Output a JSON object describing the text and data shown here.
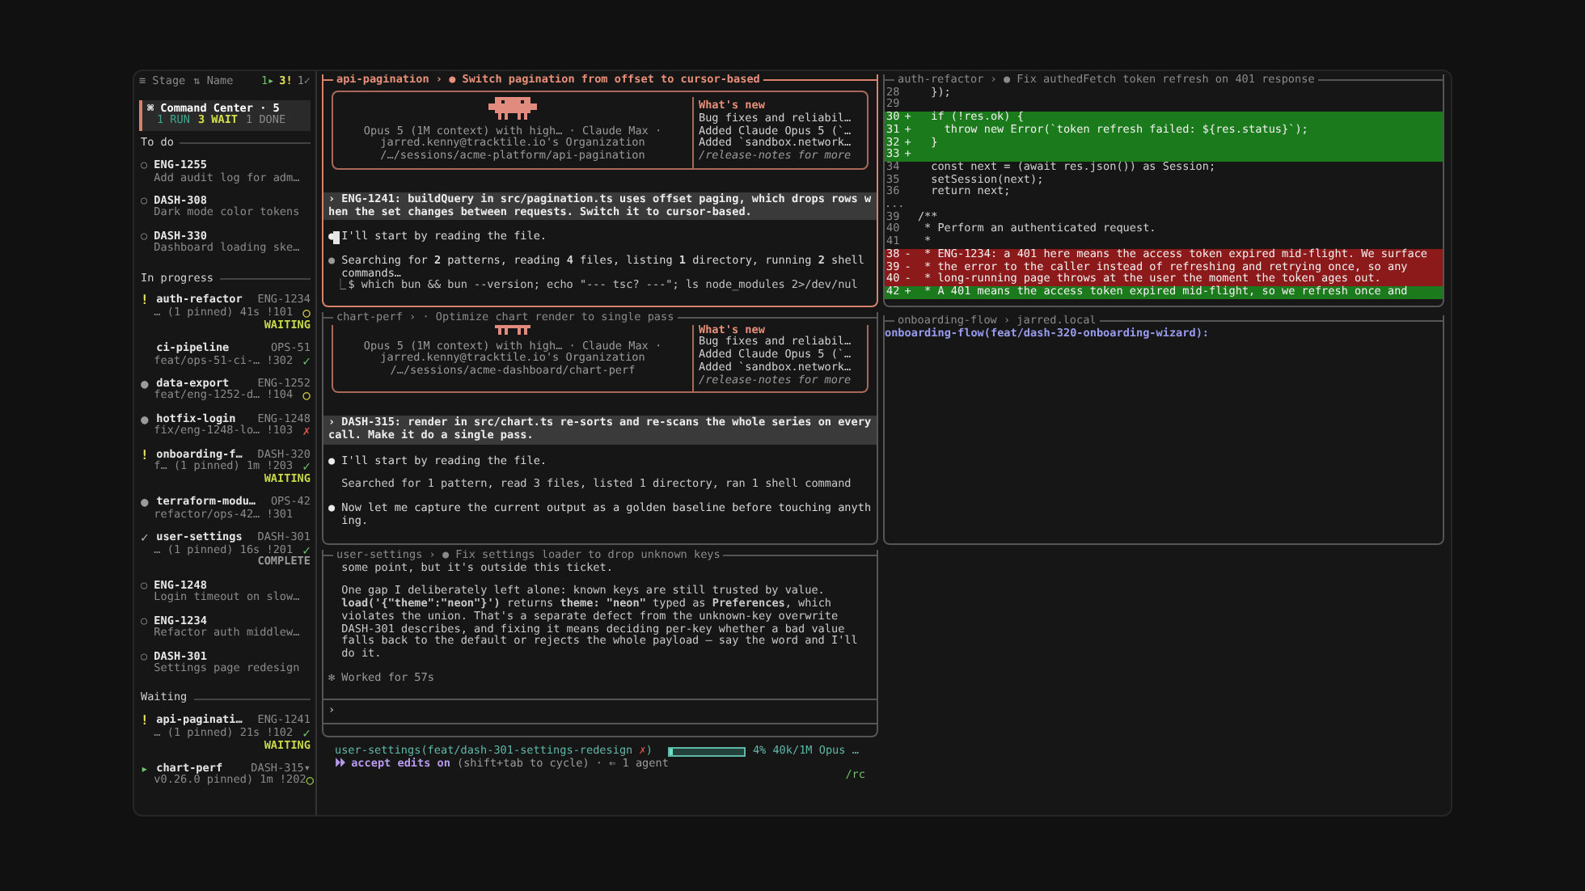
{
  "sidebar": {
    "header": {
      "stage": "≡ Stage",
      "sort": "⇅ Name",
      "counts": [
        {
          "text": "1▸",
          "kind": "run"
        },
        {
          "text": "3!",
          "kind": "wait"
        },
        {
          "text": "1✓",
          "kind": "done"
        }
      ]
    },
    "command_center": {
      "title": "⌘ Command Center · 5",
      "stats": [
        {
          "text": "1 RUN",
          "kind": "run"
        },
        {
          "text": "3 WAIT",
          "kind": "wait"
        },
        {
          "text": "1 DONE",
          "kind": "done"
        }
      ]
    },
    "groups": [
      {
        "title": "To do",
        "items": [
          {
            "kind": "ticket",
            "marker": "○",
            "id": "ENG-1255",
            "summary": "Add audit log for adm…"
          },
          {
            "kind": "ticket",
            "marker": "○",
            "id": "DASH-308",
            "summary": "Dark mode color tokens"
          },
          {
            "kind": "ticket",
            "marker": "○",
            "id": "DASH-330",
            "summary": "Dashboard loading ske…"
          }
        ]
      },
      {
        "title": "In progress",
        "items": [
          {
            "kind": "session",
            "marker": "!",
            "color": "#e6e05a",
            "name": "auth-refactor",
            "ticket": "ENG-1234",
            "detail": "… (1 pinned) 41s !101",
            "status_icon": {
              "glyph": "○",
              "color": "#d8c94a"
            },
            "status": {
              "text": "WAITING",
              "kind": "waiting"
            }
          },
          {
            "kind": "session",
            "name": "ci-pipeline",
            "ticket": "OPS-51",
            "detail": "feat/ops-51-ci-… !302",
            "status_icon": {
              "glyph": "✓",
              "color": "#6fc26a"
            }
          },
          {
            "kind": "session",
            "marker": "●",
            "color": "#9a9a9a",
            "name": "data-export",
            "ticket": "ENG-1252",
            "detail": "feat/eng-1252-d… !104",
            "status_icon": {
              "glyph": "○",
              "color": "#d8c94a"
            }
          },
          {
            "kind": "session",
            "marker": "●",
            "color": "#9a9a9a",
            "name": "hotfix-login",
            "ticket": "ENG-1248",
            "detail": "fix/eng-1248-lo… !103",
            "status_icon": {
              "glyph": "✗",
              "color": "#d9534a"
            }
          },
          {
            "kind": "session",
            "marker": "!",
            "color": "#e6e05a",
            "name": "onboarding-f…",
            "ticket": "DASH-320",
            "detail": "f… (1 pinned) 1m !203",
            "status_icon": {
              "glyph": "✓",
              "color": "#6fc26a"
            },
            "status": {
              "text": "WAITING",
              "kind": "waiting"
            }
          },
          {
            "kind": "session",
            "marker": "●",
            "color": "#9a9a9a",
            "name": "terraform-modu…",
            "ticket": "OPS-42",
            "detail": "refactor/ops-42… !301"
          },
          {
            "kind": "session",
            "marker": "✓",
            "color": "#b4b4b4",
            "name": "user-settings",
            "ticket": "DASH-301",
            "detail": "… (1 pinned) 16s !201",
            "status_icon": {
              "glyph": "✓",
              "color": "#6fc26a"
            },
            "status": {
              "text": "COMPLETE",
              "kind": "complete"
            }
          },
          {
            "kind": "ticket",
            "marker": "○",
            "id": "ENG-1248",
            "summary": "Login timeout on slow…"
          },
          {
            "kind": "ticket",
            "marker": "○",
            "id": "ENG-1234",
            "summary": "Refactor auth middlew…"
          },
          {
            "kind": "ticket",
            "marker": "○",
            "id": "DASH-301",
            "summary": "Settings page redesign"
          }
        ]
      },
      {
        "title": "Waiting",
        "items": [
          {
            "kind": "session",
            "marker": "!",
            "color": "#e6e05a",
            "name": "api-paginati…",
            "ticket": "ENG-1241",
            "detail": "… (1 pinned) 21s !102",
            "status_icon": {
              "glyph": "✓",
              "color": "#6fc26a"
            },
            "status": {
              "text": "WAITING",
              "kind": "waiting"
            }
          },
          {
            "kind": "session",
            "marker": "▸",
            "color": "#6fc26a",
            "name": "chart-perf",
            "ticket": "DASH-315▾",
            "detail": "v0.26.0 pinned) 1m !202",
            "status_icon": {
              "glyph": "○",
              "color": "#8fc24a"
            }
          }
        ]
      }
    ]
  },
  "middle_column": {
    "panes": [
      {
        "kind": "chat",
        "focused": true,
        "title": "api-pagination › ● Switch pagination from offset to cursor-based",
        "welcome": {
          "cut_off": false,
          "lines": [
            "Opus 5 (1M context) with high… · Claude Max ·",
            "jarred.kenny@tracktile.io's Organization",
            "/…/sessions/acme-platform/api-pagination"
          ],
          "whats_new": {
            "title": "What's new",
            "lines": [
              "Bug fixes and reliabil…",
              "Added Claude Opus 5 (`…",
              "Added `sandbox.network…"
            ],
            "footer": "/release-notes for more"
          }
        },
        "prompt": {
          "mark": "›",
          "text": "ENG-1241: buildQuery in src/pagination.ts uses offset paging, which drops rows when the set changes between requests. Switch it to cursor-based."
        },
        "messages": [
          {
            "kind": "assistant",
            "bullet": "●",
            "cursor": true,
            "text": "I'll start by reading the file."
          },
          {
            "kind": "tool",
            "bullet": "●",
            "text": "Searching for **2** patterns, reading **4** files, listing **1** directory, running **2** shell commands…"
          },
          {
            "kind": "output",
            "mark": "⎿",
            "text": "$ which bun && bun --version; echo \"--- tsc? ---\"; ls node_modules 2>/dev/nul"
          }
        ]
      },
      {
        "kind": "chat",
        "focused": false,
        "title": "chart-perf › · Optimize chart render to single pass",
        "welcome": {
          "cut_off": true,
          "lines": [
            "Opus 5 (1M context) with high… · Claude Max ·",
            "jarred.kenny@tracktile.io's Organization",
            "/…/sessions/acme-dashboard/chart-perf"
          ],
          "whats_new": {
            "title": "What's new",
            "lines": [
              "Bug fixes and reliabil…",
              "Added Claude Opus 5 (`…",
              "Added `sandbox.network…"
            ],
            "footer": "/release-notes for more"
          }
        },
        "prompt": {
          "mark": "›",
          "text": "DASH-315: render in src/chart.ts re-sorts and re-scans the whole series on every call. Make it do a single pass."
        },
        "messages": [
          {
            "kind": "assistant",
            "bullet": "●",
            "cursor": false,
            "text": "I'll start by reading the file."
          },
          {
            "kind": "plain",
            "text": "Searched for 1 pattern, read 3 files, listed 1 directory, ran 1 shell command"
          },
          {
            "kind": "assistant",
            "bullet": "●",
            "cursor": false,
            "text": "Now let me capture the current output as a golden baseline before touching anything."
          }
        ]
      },
      {
        "kind": "chat",
        "focused": false,
        "title": "user-settings › ● Fix settings loader to drop unknown keys",
        "messages": [
          {
            "kind": "plain",
            "text": "some point, but it's outside this ticket."
          },
          {
            "kind": "plain",
            "text": "One gap I deliberately left alone: known keys are still trusted by value. **load('{\"theme\":\"neon\"}')** returns **theme: \"neon\"** typed as **Preferences**, which violates the union. That's a separate defect from the unknown-key overwrite DASH-301 describes, and fixing it means deciding per-key whether a bad value falls back to the default or rejects the whole payload — say the word and I'll do it."
          },
          {
            "kind": "timing",
            "bullet": "✻",
            "text": "Worked for 57s"
          }
        ],
        "input": {
          "prompt": "›"
        }
      }
    ],
    "status_bar": {
      "branch": "user-settings(feat/dash-301-settings-redesign",
      "dirty_mark": "✗",
      "suffix": ")",
      "context": {
        "level": 0.04,
        "reading": "4% 40k/1M Opus …"
      },
      "mode": "⏵⏵ accept edits on",
      "hint": "(shift+tab to cycle) · ⇐ 1 agent",
      "shortcut": "/rc"
    }
  },
  "right_column": {
    "panes": [
      {
        "kind": "diff",
        "focused": false,
        "title": "auth-refactor › ● Fix authedFetch token refresh on 401 response",
        "lines": [
          {
            "kind": "context",
            "num": "28",
            "text": "  });"
          },
          {
            "kind": "context",
            "num": "29"
          },
          {
            "kind": "add",
            "num": "30",
            "sign": "+",
            "text": "  if (!res.ok) {"
          },
          {
            "kind": "add",
            "num": "31",
            "sign": "+",
            "text": "    throw new Error(`token refresh failed: ${res.status}`);"
          },
          {
            "kind": "add",
            "num": "32",
            "sign": "+",
            "text": "  }"
          },
          {
            "kind": "add",
            "num": "33",
            "sign": "+"
          },
          {
            "kind": "context",
            "num": "34",
            "text": "  const next = (await res.json()) as Session;"
          },
          {
            "kind": "context",
            "num": "35",
            "text": "  setSession(next);"
          },
          {
            "kind": "context",
            "num": "36",
            "text": "  return next;"
          },
          {
            "kind": "gap",
            "text": "..."
          },
          {
            "kind": "context",
            "num": "39",
            "text": "/**"
          },
          {
            "kind": "context",
            "num": "40",
            "text": " * Perform an authenticated request."
          },
          {
            "kind": "context",
            "num": "41",
            "text": " *"
          },
          {
            "kind": "del",
            "num": "38",
            "sign": "-",
            "text": " * ENG-1234: a 401 here means the access token expired mid-flight. We surface"
          },
          {
            "kind": "del",
            "num": "39",
            "sign": "-",
            "text": " * the error to the caller instead of refreshing and retrying once, so any"
          },
          {
            "kind": "del",
            "num": "40",
            "sign": "-",
            "text": " * long-running page throws at the user the moment the token ages out."
          },
          {
            "kind": "add",
            "num": "42",
            "sign": "+",
            "text": " * A 401 means the access token expired mid-flight, so we refresh once and"
          }
        ]
      },
      {
        "kind": "shell",
        "focused": false,
        "title": "onboarding-flow › jarred.local",
        "lines": [
          "onboarding-flow(feat/dash-320-onboarding-wizard):"
        ]
      }
    ]
  }
}
